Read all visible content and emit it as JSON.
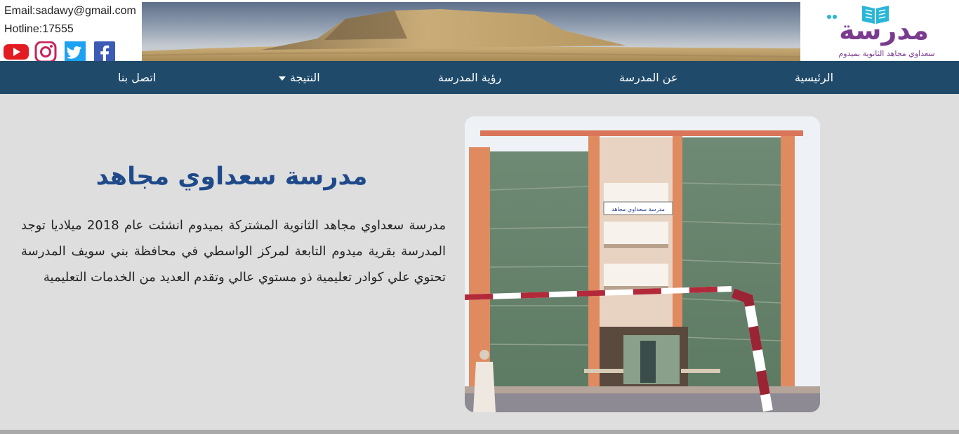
{
  "header": {
    "email": "Email:sadawy@gmail.com",
    "hotline": "Hotline:17555",
    "socials": [
      "youtube-icon",
      "instagram-icon",
      "twitter-icon",
      "facebook-icon"
    ],
    "logo_text": "مدرسة",
    "logo_subtitle": "سعداوي مجاهد الثانوية بميدوم"
  },
  "nav": {
    "items": [
      {
        "label": "الرئيسية"
      },
      {
        "label": "عن المدرسة"
      },
      {
        "label": "رؤية المدرسة"
      },
      {
        "label": "النتيجة",
        "dropdown": true
      },
      {
        "label": "اتصل بنا"
      }
    ]
  },
  "main": {
    "title": "مدرسة سعداوي مجاهد",
    "description": "مدرسة سعداوي مجاهد الثانوية المشتركة بميدوم انشئت عام 2018 ميلاديا توجد المدرسة بقرية ميدوم التابعة لمركز الواسطي في محافظة بني سويف المدرسة تحتوي علي كوادر تعليمية ذو مستوي عالي وتقدم العديد من الخدمات التعليمية",
    "building_sign": "مدرسة سعداوي مجاهد"
  },
  "colors": {
    "nav_bg": "#1f4a6a",
    "title": "#1f4a8a",
    "page_bg": "#dedede",
    "logo_purple": "#7a3b8f",
    "logo_cyan": "#2bb6d8"
  }
}
